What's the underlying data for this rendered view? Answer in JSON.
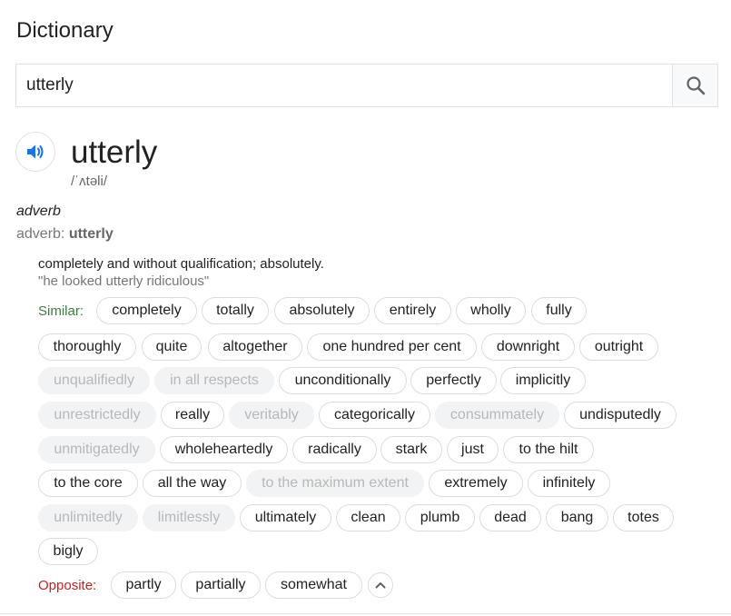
{
  "header": {
    "title": "Dictionary"
  },
  "search": {
    "value": "utterly",
    "button_icon": "search-icon"
  },
  "entry": {
    "headword": "utterly",
    "phonetic": "/ˈʌtəli/",
    "audio_icon": "speaker-icon",
    "part_of_speech": "adverb",
    "forms_label": "adverb: ",
    "forms_value": "utterly",
    "definition": "completely and without qualification; absolutely.",
    "example": "\"he looked utterly ridiculous\""
  },
  "similar": {
    "label": "Similar:",
    "words": [
      {
        "text": "completely",
        "faded": false
      },
      {
        "text": "totally",
        "faded": false
      },
      {
        "text": "absolutely",
        "faded": false
      },
      {
        "text": "entirely",
        "faded": false
      },
      {
        "text": "wholly",
        "faded": false
      },
      {
        "text": "fully",
        "faded": false
      },
      {
        "text": "thoroughly",
        "faded": false
      },
      {
        "text": "quite",
        "faded": false
      },
      {
        "text": "altogether",
        "faded": false
      },
      {
        "text": "one hundred per cent",
        "faded": false
      },
      {
        "text": "downright",
        "faded": false
      },
      {
        "text": "outright",
        "faded": false
      },
      {
        "text": "unqualifiedly",
        "faded": true
      },
      {
        "text": "in all respects",
        "faded": true
      },
      {
        "text": "unconditionally",
        "faded": false
      },
      {
        "text": "perfectly",
        "faded": false
      },
      {
        "text": "implicitly",
        "faded": false
      },
      {
        "text": "unrestrictedly",
        "faded": true
      },
      {
        "text": "really",
        "faded": false
      },
      {
        "text": "veritably",
        "faded": true
      },
      {
        "text": "categorically",
        "faded": false
      },
      {
        "text": "consummately",
        "faded": true
      },
      {
        "text": "undisputedly",
        "faded": false
      },
      {
        "text": "unmitigatedly",
        "faded": true
      },
      {
        "text": "wholeheartedly",
        "faded": false
      },
      {
        "text": "radically",
        "faded": false
      },
      {
        "text": "stark",
        "faded": false
      },
      {
        "text": "just",
        "faded": false
      },
      {
        "text": "to the hilt",
        "faded": false
      },
      {
        "text": "to the core",
        "faded": false
      },
      {
        "text": "all the way",
        "faded": false
      },
      {
        "text": "to the maximum extent",
        "faded": true
      },
      {
        "text": "extremely",
        "faded": false
      },
      {
        "text": "infinitely",
        "faded": false
      },
      {
        "text": "unlimitedly",
        "faded": true
      },
      {
        "text": "limitlessly",
        "faded": true
      },
      {
        "text": "ultimately",
        "faded": false
      },
      {
        "text": "clean",
        "faded": false
      },
      {
        "text": "plumb",
        "faded": false
      },
      {
        "text": "dead",
        "faded": false
      },
      {
        "text": "bang",
        "faded": false
      },
      {
        "text": "totes",
        "faded": false
      },
      {
        "text": "bigly",
        "faded": false
      }
    ]
  },
  "opposite": {
    "label": "Opposite:",
    "words": [
      {
        "text": "partly",
        "faded": false
      },
      {
        "text": "partially",
        "faded": false
      },
      {
        "text": "somewhat",
        "faded": false
      }
    ],
    "collapse_icon": "chevron-up-icon"
  },
  "colors": {
    "similar_label": "#3c7d3e",
    "opposite_label": "#c5221f",
    "audio_icon": "#1a73e8"
  }
}
